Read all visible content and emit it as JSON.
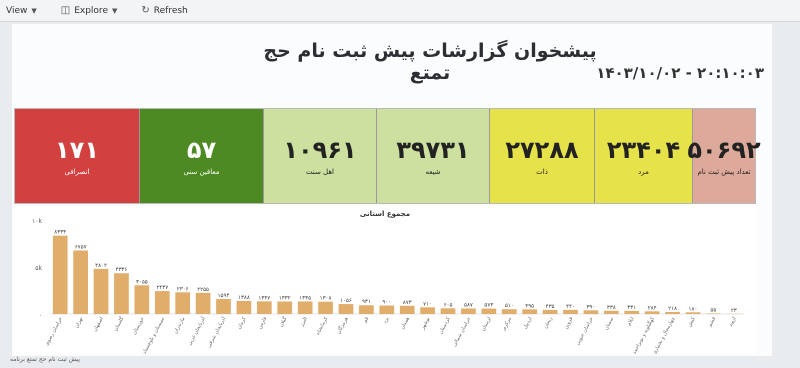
{
  "toolbar": {
    "view_label": "View",
    "explore_label": "Explore",
    "refresh_label": "Refresh"
  },
  "header": {
    "title": "پیشخوان گزارشات پیش ثبت نام حج تمتع",
    "datetime": "۱۴۰۳/۱۰/۰۲ - ۲۰:۱۰:۰۳"
  },
  "tiles": [
    {
      "value": "۱۷۱",
      "label": "انصرافی",
      "bg": "#d2403f",
      "fg": "#ffffff"
    },
    {
      "value": "۵۷",
      "label": "معافین سنی",
      "bg": "#4e8a23",
      "fg": "#ffffff"
    },
    {
      "value": "۱۰۹۶۱",
      "label": "اهل سنت",
      "bg": "#cde0a0",
      "fg": "#222222"
    },
    {
      "value": "۳۹۷۳۱",
      "label": "شیعه",
      "bg": "#cde0a0",
      "fg": "#222222"
    },
    {
      "value": "۲۷۲۸۸",
      "label": "ذات",
      "bg": "#e6e34a",
      "fg": "#222222"
    },
    {
      "value": "۲۳۴۰۴",
      "label": "مرد",
      "bg": "#e6e34a",
      "fg": "#222222"
    },
    {
      "value": "۵۰۶۹۲",
      "label": "تعداد پیش ثبت نام",
      "bg": "#dca99a",
      "fg": "#222222"
    }
  ],
  "footer_text": "پیش ثبت نام حج تمتع برنامه",
  "chart_data": {
    "type": "bar",
    "title": "مجموع استانی",
    "ylim": [
      0,
      10000
    ],
    "yticks": [
      "۱۰k",
      "۵k",
      "۰"
    ],
    "color": "#e0ad6a",
    "values": [
      8333,
      6757,
      4802,
      4336,
      3055,
      2437,
      2306,
      2255,
      1594,
      1388,
      1347,
      1332,
      1335,
      1308,
      1056,
      931,
      900,
      873,
      710,
      605,
      587,
      573,
      510,
      495,
      435,
      440,
      390,
      338,
      331,
      284,
      218,
      180,
      55,
      23
    ],
    "value_labels": [
      "۸۳۳۳",
      "۶۷۵۷",
      "۴۸۰۲",
      "۴۳۳۶",
      "۳۰۵۵",
      "۲۴۳۷",
      "۲۳۰۶",
      "۲۲۵۵",
      "۱۵۹۴",
      "۱۳۸۸",
      "۱۳۴۷",
      "۱۳۳۲",
      "۱۳۳۵",
      "۱۳۰۸",
      "۱۰۵۶",
      "۹۳۱",
      "۹۰۰",
      "۸۷۳",
      "۷۱۰",
      "۶۰۵",
      "۵۸۷",
      "۵۷۳",
      "۵۱۰",
      "۴۹۵",
      "۴۳۵",
      "۴۴۰",
      "۳۹۰",
      "۳۳۸",
      "۳۳۱",
      "۲۸۴",
      "۲۱۸",
      "۱۸۰",
      "۵۵",
      "۲۳"
    ],
    "categories": [
      "خراسان رضوی",
      "تهران",
      "اصفهان",
      "گلستان",
      "خوزستان",
      "سیستان و بلوچستان",
      "مازندران",
      "آذربایجان غربی",
      "آذربایجان شرقی",
      "کرمان",
      "فارس",
      "گیلان",
      "البرز",
      "کرمانشاه",
      "هرمزگان",
      "قم",
      "یزد",
      "همدان",
      "بوشهر",
      "کردستان",
      "خراسان شمالی",
      "لرستان",
      "مرکزی",
      "اردبیل",
      "زنجان",
      "قزوین",
      "خراسان جنوبی",
      "سمنان",
      "ایلام",
      "کهگیلویه و بویراحمد",
      "چهارمحال و بختیاری",
      "کیش",
      "قشم",
      "اروند"
    ]
  }
}
